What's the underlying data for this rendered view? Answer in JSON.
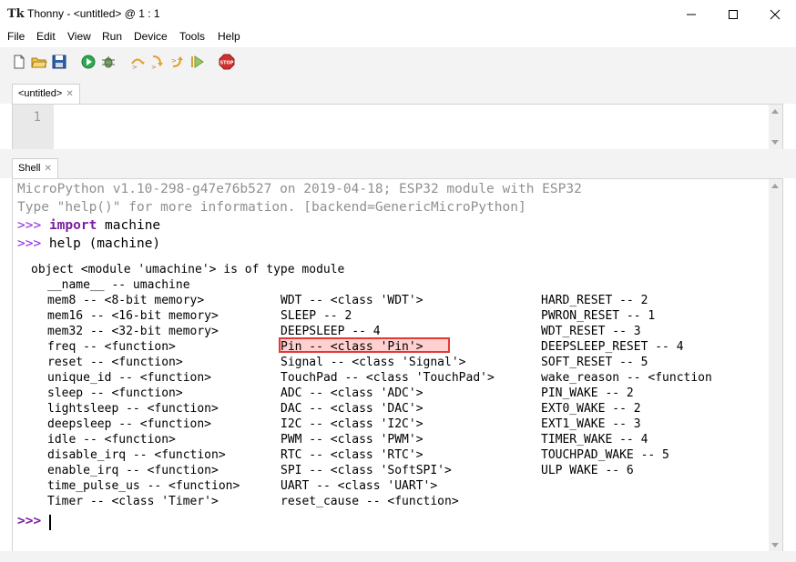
{
  "window": {
    "title": "Thonny  -  <untitled>  @  1 : 1",
    "app_icon": "Tk"
  },
  "menu": [
    "File",
    "Edit",
    "View",
    "Run",
    "Device",
    "Tools",
    "Help"
  ],
  "toolbar": {
    "icons": [
      "new-file-icon",
      "open-file-icon",
      "save-icon",
      "run-icon",
      "debug-icon",
      "step-over-icon",
      "step-into-icon",
      "step-out-icon",
      "resume-icon",
      "stop-icon"
    ],
    "stop_label": "STOP"
  },
  "editor": {
    "tab_label": "<untitled>",
    "line_numbers": [
      "1"
    ]
  },
  "shell": {
    "tab_label": "Shell",
    "banner_1": "MicroPython v1.10-298-g47e76b527 on 2019-04-18; ESP32 module with ESP32",
    "banner_2": "Type \"help()\" for more information. [backend=GenericMicroPython]",
    "prompt": ">>>",
    "cmd1_kw": "import",
    "cmd1_rest": " machine",
    "cmd2": " help (machine)",
    "out_header": "object <module 'umachine'> is of type module",
    "out_name": "__name__ -- umachine",
    "col1": [
      "mem8 -- <8-bit memory>",
      "mem16 -- <16-bit memory>",
      "mem32 -- <32-bit memory>",
      "freq -- <function>",
      "reset -- <function>",
      "unique_id -- <function>",
      "sleep -- <function>",
      "lightsleep -- <function>",
      "deepsleep -- <function>",
      "idle -- <function>",
      "disable_irq -- <function>",
      "enable_irq -- <function>",
      "time_pulse_us -- <function>",
      "Timer -- <class 'Timer'>"
    ],
    "col2": [
      "WDT -- <class 'WDT'>",
      "SLEEP -- 2",
      "DEEPSLEEP -- 4",
      "Pin -- <class 'Pin'>",
      "Signal -- <class 'Signal'>",
      "TouchPad -- <class 'TouchPad'>",
      "ADC -- <class 'ADC'>",
      "DAC -- <class 'DAC'>",
      "I2C -- <class 'I2C'>",
      "PWM -- <class 'PWM'>",
      "RTC -- <class 'RTC'>",
      "SPI -- <class 'SoftSPI'>",
      "UART -- <class 'UART'>",
      "reset_cause -- <function>"
    ],
    "col3": [
      "HARD_RESET -- 2",
      "PWRON_RESET -- 1",
      "WDT_RESET -- 3",
      "DEEPSLEEP_RESET -- 4",
      "SOFT_RESET -- 5",
      "wake_reason -- <function",
      "PIN_WAKE -- 2",
      "EXT0_WAKE -- 2",
      "EXT1_WAKE -- 3",
      "TIMER_WAKE -- 4",
      "TOUCHPAD_WAKE -- 5",
      "ULP WAKE -- 6"
    ]
  },
  "colors": {
    "prompt": "#8a2be2",
    "banner": "#909090",
    "highlight_border": "#e53935"
  }
}
